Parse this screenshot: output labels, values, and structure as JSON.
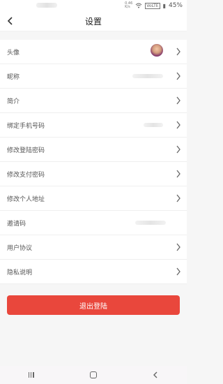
{
  "statusbar": {
    "speed_top": "0.46",
    "speed_bottom": "K/s",
    "network": "VoLTE",
    "battery": "45%"
  },
  "header": {
    "title": "设置"
  },
  "rows": [
    {
      "label": "头像"
    },
    {
      "label": "昵称"
    },
    {
      "label": "简介"
    },
    {
      "label": "绑定手机号码"
    },
    {
      "label": "修改登陆密码"
    },
    {
      "label": "修改支付密码"
    },
    {
      "label": "修改个人地址"
    },
    {
      "label": "邀请码"
    },
    {
      "label": "用户协议"
    },
    {
      "label": "隐私说明"
    }
  ],
  "logout_label": "退出登陆",
  "icons": {
    "back": "chevron-left-icon",
    "row": "chevron-right-icon",
    "wifi": "wifi-icon",
    "battery": "battery-icon"
  }
}
